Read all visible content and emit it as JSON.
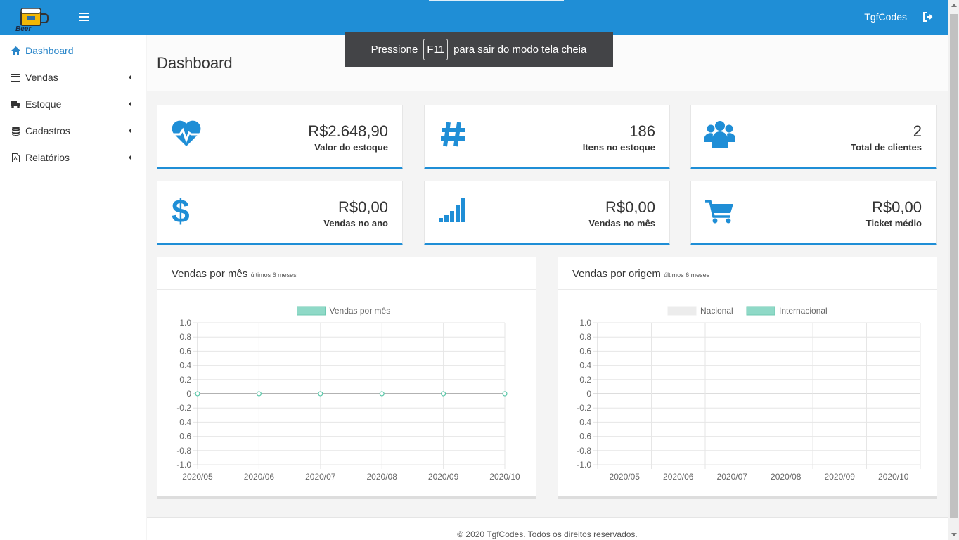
{
  "topbar": {
    "user_name": "TgfCodes",
    "logo_text": "Beer",
    "colors": {
      "primary": "#1f8ed6"
    }
  },
  "fullscreen_notice": {
    "before": "Pressione",
    "key": "F11",
    "after": "para sair do modo tela cheia"
  },
  "sidebar": {
    "items": [
      {
        "label": "Dashboard",
        "icon": "home-icon",
        "active": true
      },
      {
        "label": "Vendas",
        "icon": "credit-card-icon",
        "active": false
      },
      {
        "label": "Estoque",
        "icon": "truck-icon",
        "active": false
      },
      {
        "label": "Cadastros",
        "icon": "database-icon",
        "active": false
      },
      {
        "label": "Relatórios",
        "icon": "file-pdf-icon",
        "active": false
      }
    ]
  },
  "page": {
    "title": "Dashboard"
  },
  "cards": [
    {
      "value": "R$2.648,90",
      "label": "Valor do estoque",
      "icon": "heartbeat-icon"
    },
    {
      "value": "186",
      "label": "Itens no estoque",
      "icon": "hashtag-icon"
    },
    {
      "value": "2",
      "label": "Total de clientes",
      "icon": "users-icon"
    },
    {
      "value": "R$0,00",
      "label": "Vendas no ano",
      "icon": "dollar-icon"
    },
    {
      "value": "R$0,00",
      "label": "Vendas no mês",
      "icon": "signal-icon"
    },
    {
      "value": "R$0,00",
      "label": "Ticket médio",
      "icon": "cart-icon"
    }
  ],
  "panels": {
    "monthly": {
      "title": "Vendas por mês",
      "subtitle": "últimos 6 meses"
    },
    "origin": {
      "title": "Vendas por origem",
      "subtitle": "últimos 6 meses"
    }
  },
  "chart_data": [
    {
      "type": "line",
      "categories": [
        "2020/05",
        "2020/06",
        "2020/07",
        "2020/08",
        "2020/09",
        "2020/10"
      ],
      "series": [
        {
          "name": "Vendas por mês",
          "values": [
            0,
            0,
            0,
            0,
            0,
            0
          ],
          "color": "#8fd9c7"
        }
      ],
      "yticks": [
        "1.0",
        "0.8",
        "0.6",
        "0.4",
        "0.2",
        "0",
        "-0.2",
        "-0.4",
        "-0.6",
        "-0.8",
        "-1.0"
      ],
      "ylim": [
        -1,
        1
      ],
      "grid": true,
      "legend": "top"
    },
    {
      "type": "bar",
      "categories": [
        "2020/05",
        "2020/06",
        "2020/07",
        "2020/08",
        "2020/09",
        "2020/10"
      ],
      "series": [
        {
          "name": "Nacional",
          "values": [
            0,
            0,
            0,
            0,
            0,
            0
          ],
          "color": "#ececec"
        },
        {
          "name": "Internacional",
          "values": [
            0,
            0,
            0,
            0,
            0,
            0
          ],
          "color": "#8fd9c7"
        }
      ],
      "yticks": [
        "1.0",
        "0.8",
        "0.6",
        "0.4",
        "0.2",
        "0",
        "-0.2",
        "-0.4",
        "-0.6",
        "-0.8",
        "-1.0"
      ],
      "ylim": [
        -1,
        1
      ],
      "grid": true,
      "legend": "top"
    }
  ],
  "footer": {
    "text": "© 2020 TgfCodes. Todos os direitos reservados."
  }
}
